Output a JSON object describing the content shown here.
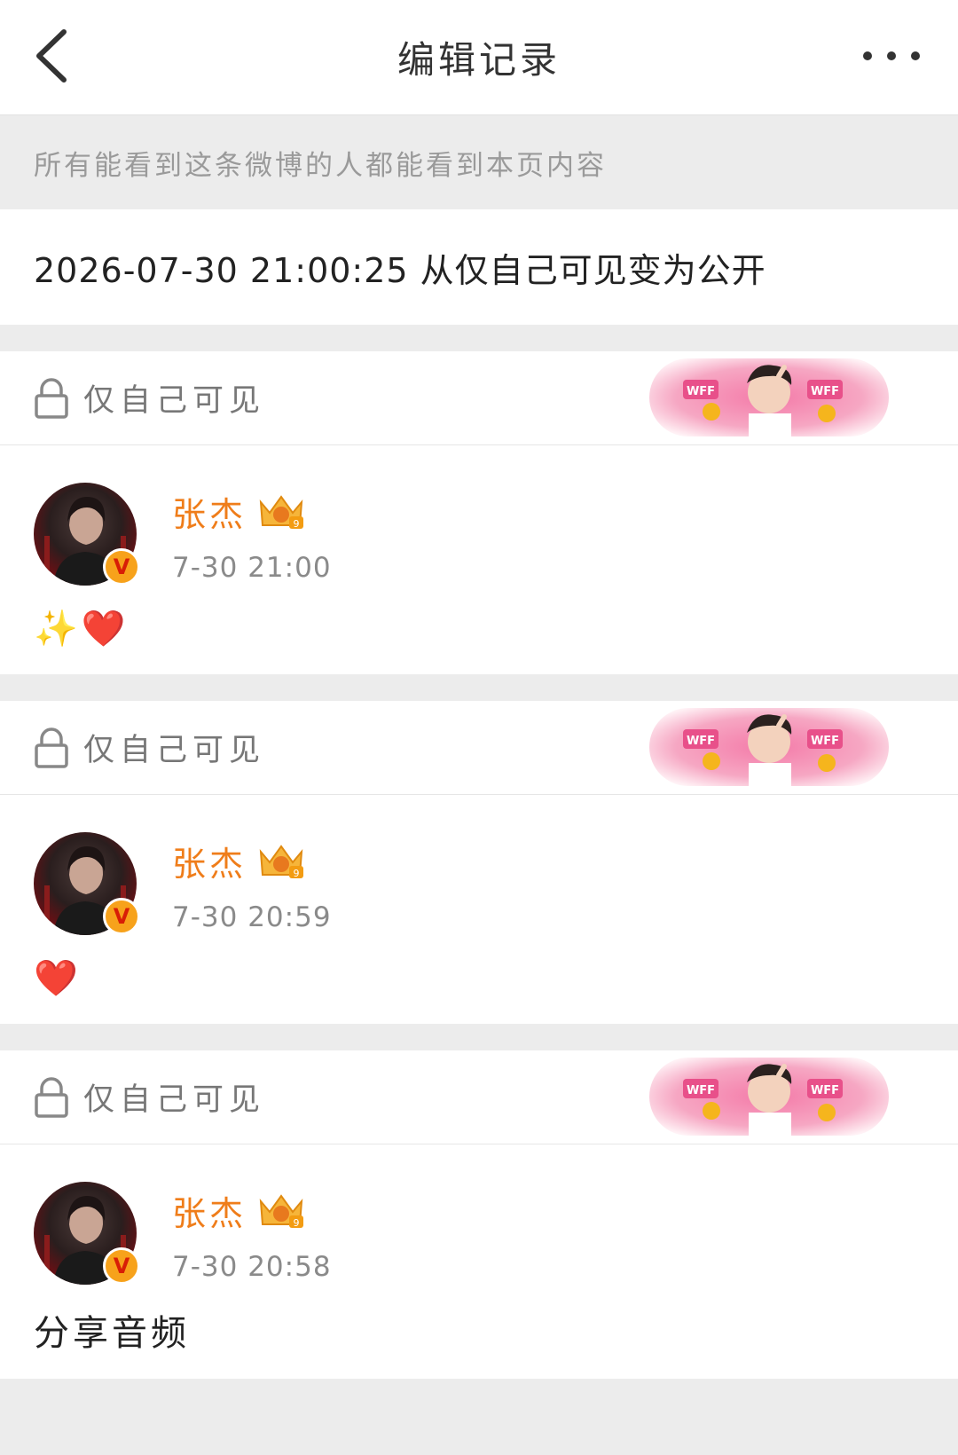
{
  "header": {
    "title": "编辑记录"
  },
  "notice": "所有能看到这条微博的人都能看到本页内容",
  "change_log": "2026-07-30 21:00:25 从仅自己可见变为公开",
  "records": [
    {
      "visibility": "仅自己可见",
      "username": "张杰",
      "time": "7-30 21:00",
      "content": "✨❤️"
    },
    {
      "visibility": "仅自己可见",
      "username": "张杰",
      "time": "7-30 20:59",
      "content": "❤️"
    },
    {
      "visibility": "仅自己可见",
      "username": "张杰",
      "time": "7-30 20:58",
      "content": "分享音频"
    }
  ],
  "banner_text": "WFF",
  "verified_badge": "V",
  "colors": {
    "username": "#ef7d1a",
    "badge": "#f7a21b",
    "background": "#ececec"
  }
}
